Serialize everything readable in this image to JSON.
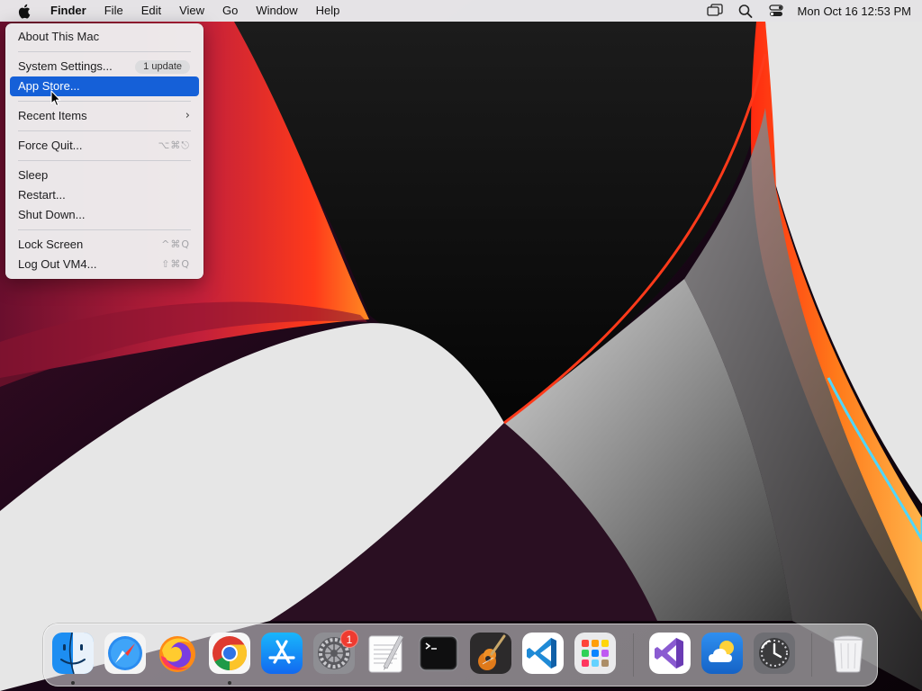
{
  "menubar": {
    "app_name": "Finder",
    "menus": [
      "File",
      "Edit",
      "View",
      "Go",
      "Window",
      "Help"
    ],
    "clock": "Mon Oct 16  12:53 PM",
    "status_icons": [
      "screen-mirroring-icon",
      "spotlight-search-icon",
      "control-center-icon"
    ]
  },
  "apple_menu": {
    "about": "About This Mac",
    "system_settings": "System Settings...",
    "system_settings_badge": "1 update",
    "app_store": "App Store...",
    "recent_items": "Recent Items",
    "recent_items_chevron": "›",
    "force_quit": "Force Quit...",
    "force_quit_shortcut": "⌥⌘⎋",
    "sleep": "Sleep",
    "restart": "Restart...",
    "shut_down": "Shut Down...",
    "lock_screen": "Lock Screen",
    "lock_screen_shortcut": "^⌘Q",
    "log_out": "Log Out VM4...",
    "log_out_shortcut": "⇧⌘Q",
    "selected_item": "App Store..."
  },
  "dock": {
    "apps": [
      "finder-icon",
      "safari-icon",
      "firefox-icon",
      "chrome-icon",
      "app-store-icon",
      "system-settings-icon",
      "textedit-icon",
      "terminal-icon",
      "garageband-icon",
      "vscode-icon",
      "launchpad-icon",
      "visual-studio-icon",
      "weather-icon",
      "time-machine-icon",
      "trash-icon"
    ],
    "system_settings_badge": "1",
    "running_apps": [
      "Finder",
      "Chrome"
    ]
  },
  "colors": {
    "selection": "#1560d8",
    "menubar": "#ececee",
    "badge_red": "#ef3b30"
  }
}
